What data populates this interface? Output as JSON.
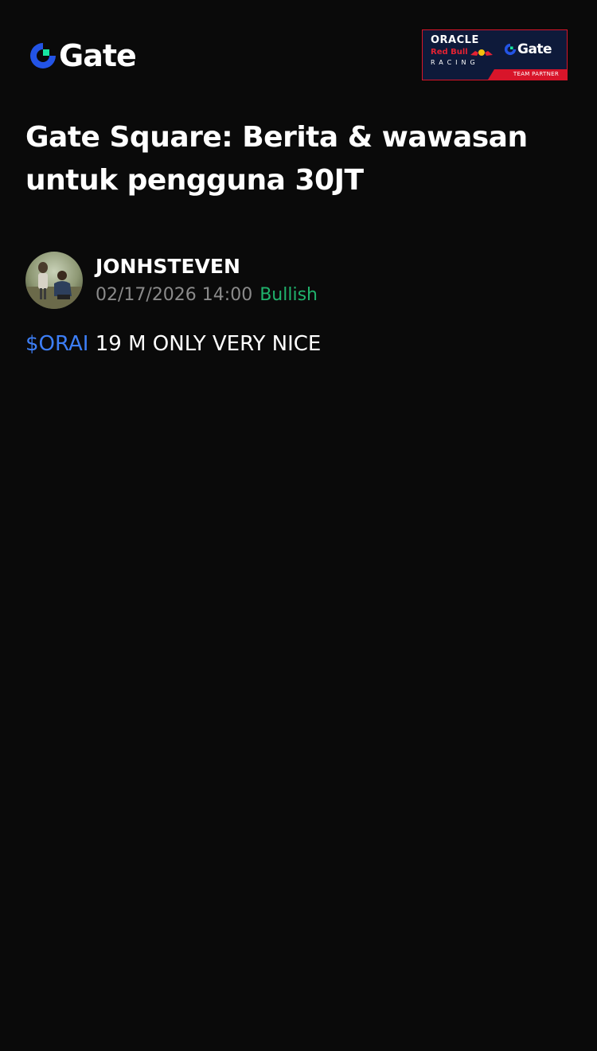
{
  "header": {
    "logo_text": "Gate",
    "partner_banner": {
      "oracle_text": "ORACLE",
      "redbull_text": "Red Bull",
      "racing_text": "RACING",
      "gate_text": "Gate",
      "strip_text": "TEAM PARTNER"
    }
  },
  "headline": "Gate Square: Berita & wawasan untuk pengguna 30JT",
  "post": {
    "author": "JONHSTEVEN",
    "timestamp": "02/17/2026 14:00",
    "sentiment": "Bullish",
    "ticker": "$ORAI",
    "body_text": " 19 M ONLY VERY NICE"
  },
  "colors": {
    "background": "#0a0a0a",
    "brand_blue": "#2354e6",
    "brand_teal": "#17e6a1",
    "ticker_blue": "#3d7ef5",
    "bullish_green": "#20b26c",
    "muted_gray": "#8a8a8a",
    "partner_navy": "#0e1a3a",
    "partner_red": "#d8152a"
  },
  "icons": {
    "logo": "gate-logo-icon",
    "avatar": "user-avatar-photo"
  }
}
